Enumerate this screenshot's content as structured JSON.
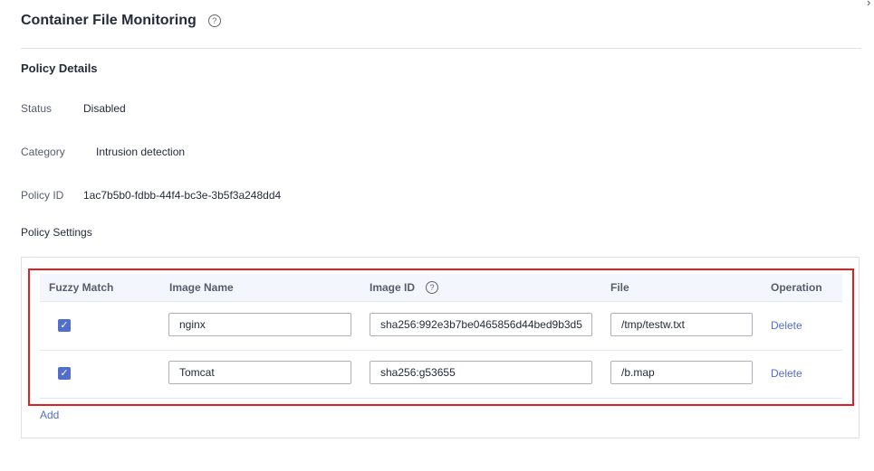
{
  "header": {
    "title": "Container File Monitoring",
    "help_icon": "question-circle-icon",
    "close_icon": "close-icon"
  },
  "policy_details": {
    "section_title": "Policy Details",
    "status_label": "Status",
    "status_value": "Disabled",
    "category_label": "Category",
    "category_value": "Intrusion detection",
    "policy_id_label": "Policy ID",
    "policy_id_value": "1ac7b5b0-fdbb-44f4-bc3e-3b5f3a248dd4"
  },
  "policy_settings": {
    "label": "Policy Settings",
    "columns": [
      "Fuzzy Match",
      "Image Name",
      "Image ID",
      "File",
      "Operation"
    ],
    "rows": [
      {
        "fuzzy_match": true,
        "image_name": "nginx",
        "image_id": "sha256:992e3b7be0465856d44bed9b3d5",
        "file": "/tmp/testw.txt",
        "operation": "Delete"
      },
      {
        "fuzzy_match": true,
        "image_name": "Tomcat",
        "image_id": "sha256:g53655",
        "file": "/b.map",
        "operation": "Delete"
      }
    ],
    "add_label": "Add"
  },
  "colors": {
    "accent": "#526ecc",
    "highlight_border": "#e02020"
  }
}
